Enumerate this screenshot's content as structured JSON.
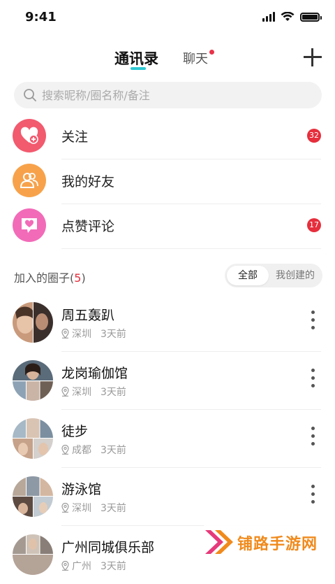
{
  "status_bar": {
    "time": "9:41"
  },
  "header": {
    "tab_contacts": "通讯录",
    "tab_chat": "聊天"
  },
  "search": {
    "placeholder": "搜索昵称/圈名称/备注"
  },
  "menu": [
    {
      "label": "关注",
      "badge": "32",
      "color": "#f25a6e",
      "icon": "heart-plus-icon"
    },
    {
      "label": "我的好友",
      "badge": "",
      "color": "#f7a24b",
      "icon": "friends-icon"
    },
    {
      "label": "点赞评论",
      "badge": "17",
      "color": "#f26bb8",
      "icon": "heart-comment-icon"
    }
  ],
  "groups_section": {
    "title": "加入的圈子(",
    "count": "5",
    "title_end": ")",
    "filter_all": "全部",
    "filter_created": "我创建的"
  },
  "groups": [
    {
      "name": "周五轰趴",
      "location": "深圳",
      "time": "3天前"
    },
    {
      "name": "龙岗瑜伽馆",
      "location": "深圳",
      "time": "3天前"
    },
    {
      "name": "徒步",
      "location": "成都",
      "time": "3天前"
    },
    {
      "name": "游泳馆",
      "location": "深圳",
      "time": "3天前"
    },
    {
      "name": "广州同城俱乐部",
      "location": "广州",
      "time": "3天前"
    }
  ],
  "watermark": {
    "text": "铺路手游网"
  },
  "colors": {
    "accent": "#2ec8d2",
    "badge": "#e62e3c",
    "watermark": "#f08a1c"
  }
}
